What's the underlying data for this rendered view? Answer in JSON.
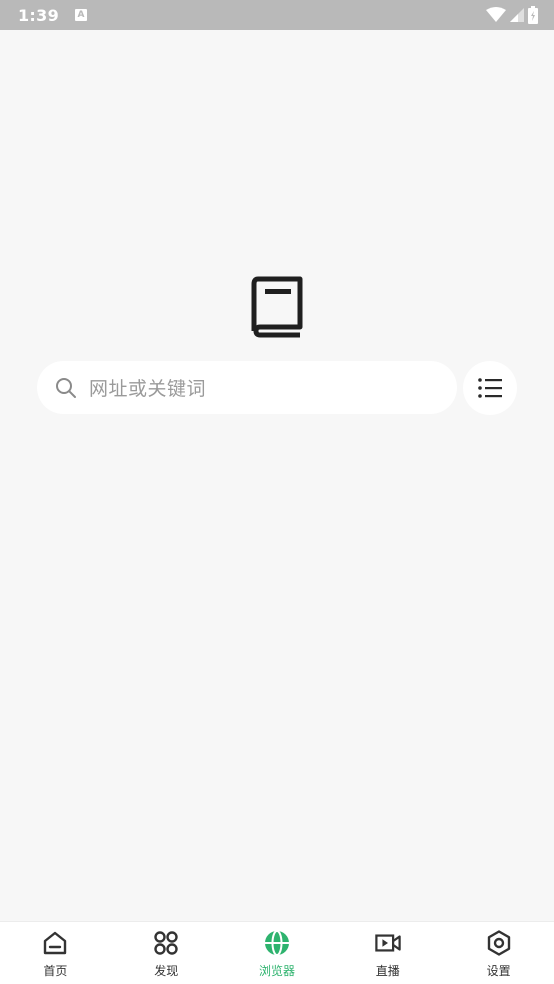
{
  "status_bar": {
    "time": "1:39",
    "notification_icon": "A"
  },
  "search": {
    "placeholder": "网址或关键词"
  },
  "bottom_nav": {
    "items": [
      {
        "label": "首页",
        "icon": "home-icon",
        "active": false
      },
      {
        "label": "发现",
        "icon": "discover-icon",
        "active": false
      },
      {
        "label": "浏览器",
        "icon": "globe-icon",
        "active": true
      },
      {
        "label": "直播",
        "icon": "video-icon",
        "active": false
      },
      {
        "label": "设置",
        "icon": "settings-icon",
        "active": false
      }
    ]
  },
  "colors": {
    "accent": "#2eb36e",
    "background": "#f7f7f7",
    "status_bar": "#b9b9b9"
  }
}
